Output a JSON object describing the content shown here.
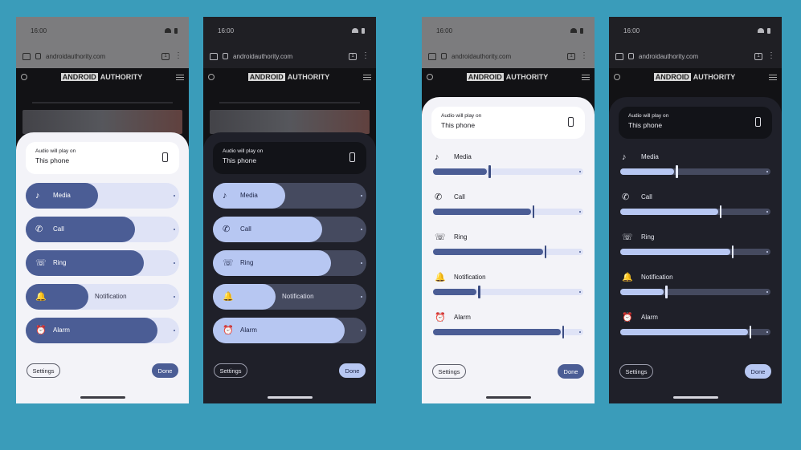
{
  "status_bar": {
    "time": "16:00"
  },
  "browser": {
    "url": "androidauthority.com",
    "tab_count": "1",
    "more_glyph": "⋮"
  },
  "site": {
    "logo_left": "ANDROID",
    "logo_right": "AUTHORITY"
  },
  "output": {
    "caption": "Audio will play on",
    "device": "This phone"
  },
  "labels": {
    "media": "Media",
    "call": "Call",
    "ring": "Ring",
    "notification": "Notification",
    "alarm": "Alarm"
  },
  "icons": {
    "media": "music-note-icon",
    "call": "phone-call-icon",
    "ring": "ring-vibrate-icon",
    "notification": "bell-icon",
    "alarm": "alarm-clock-icon"
  },
  "glyphs": {
    "media": "♪",
    "call": "✆",
    "ring": "☏",
    "notification": "🔔",
    "alarm": "⏰"
  },
  "levels_pill": {
    "media": 0.47,
    "call": 0.71,
    "ring": 0.77,
    "notification": 0.41,
    "alarm": 0.86
  },
  "levels_slider": {
    "media": 0.36,
    "call": 0.65,
    "ring": 0.73,
    "notification": 0.29,
    "alarm": 0.85
  },
  "buttons": {
    "settings": "Settings",
    "done": "Done"
  },
  "colors": {
    "background": "#3a9cba",
    "light_accent": "#4b5d95",
    "light_track": "#dfe3f6",
    "dark_accent": "#b7c7f2",
    "dark_track": "#454a5f"
  }
}
